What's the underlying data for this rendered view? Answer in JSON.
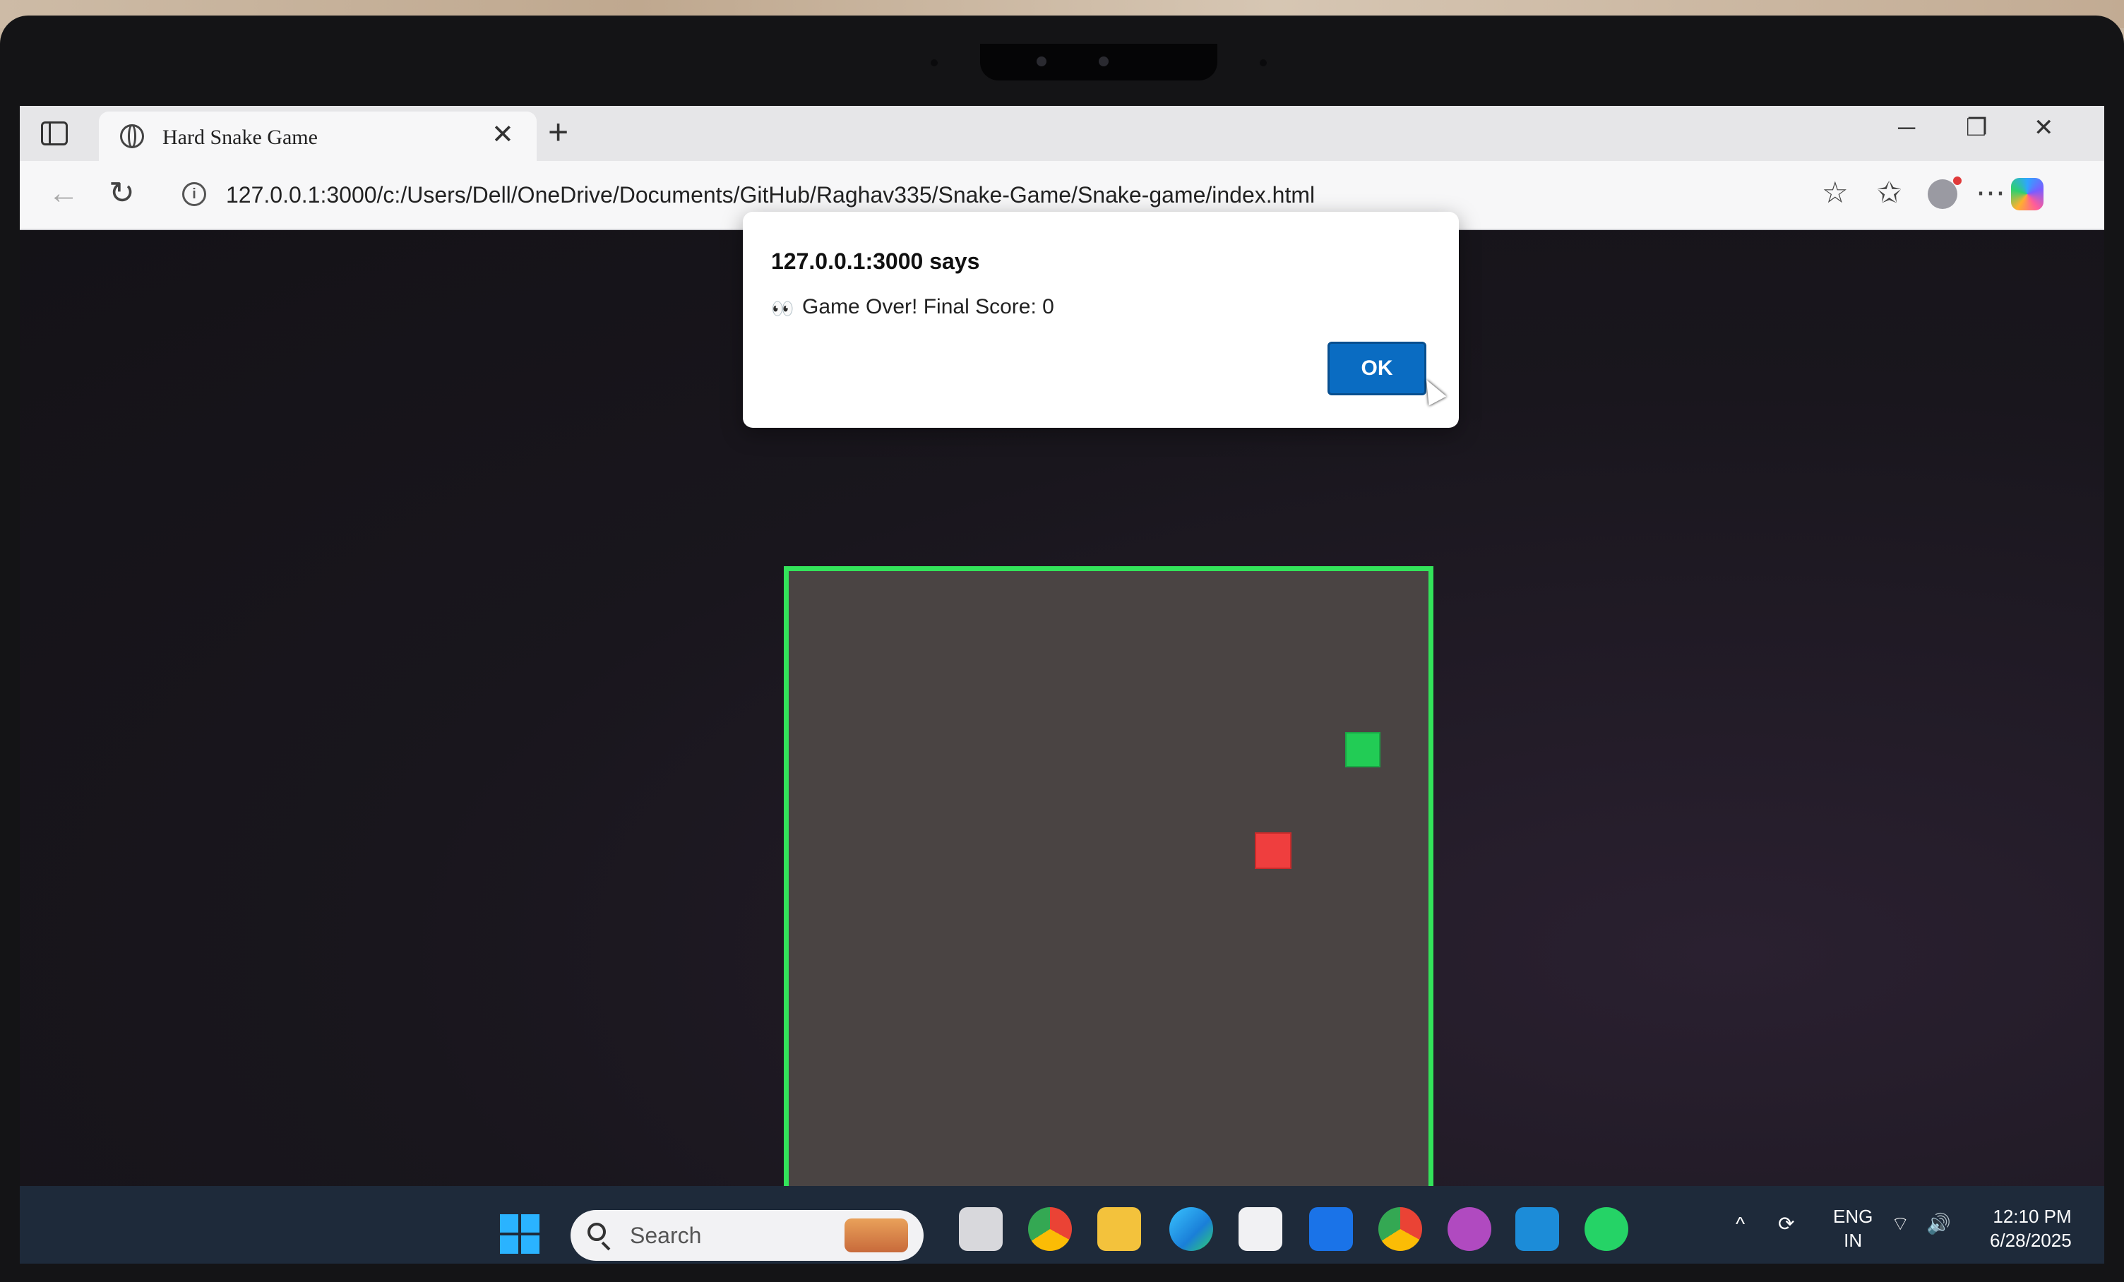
{
  "browser": {
    "tab_title": "Hard Snake Game",
    "tab_close": "✕",
    "new_tab": "+",
    "window_controls": {
      "minimize": "─",
      "restore": "❐",
      "close": "✕"
    },
    "url": "127.0.0.1:3000/c:/Users/Dell/OneDrive/Documents/GitHub/Raghav335/Snake-Game/Snake-game/index.html",
    "nav": {
      "back": "←",
      "reload": "↻"
    },
    "info_icon": "i",
    "toolbar": {
      "favorite": "☆",
      "favorites": "✩",
      "more": "⋯"
    }
  },
  "dialog": {
    "title": "127.0.0.1:3000 says",
    "message_icon": "👀",
    "message": "Game Over! Final Score: 0",
    "ok_label": "OK"
  },
  "game": {
    "board_border_color": "#33e35a",
    "board_color": "#4a4443",
    "food_color": "#22cc55",
    "snake_color": "#ef3e3e"
  },
  "taskbar": {
    "search_placeholder": "Search",
    "tray_chevron": "^",
    "tray_sync": "⟳",
    "language": "ENG",
    "region": "IN",
    "wifi": "⌔",
    "volume": "🔊",
    "time": "12:10 PM",
    "date": "6/28/2025"
  }
}
